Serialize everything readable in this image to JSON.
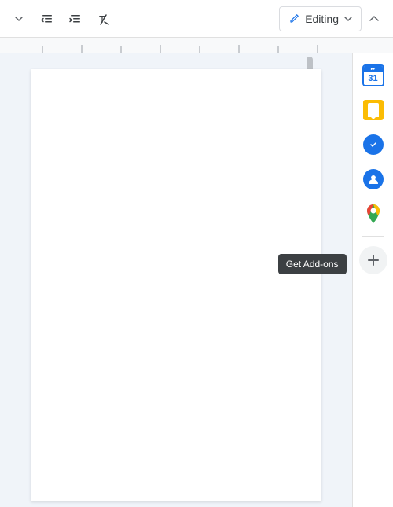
{
  "toolbar": {
    "editing_label": "Editing",
    "list_decrease_icon": "list-decrease-icon",
    "list_increase_icon": "list-increase-icon",
    "clear_format_icon": "clear-format-icon",
    "collapse_icon": "collapse-icon"
  },
  "sidebar": {
    "addons": [
      {
        "id": "google-calendar",
        "label": "Google Calendar",
        "type": "calendar"
      },
      {
        "id": "google-keep",
        "label": "Google Keep",
        "type": "keep"
      },
      {
        "id": "google-tasks",
        "label": "Google Tasks",
        "type": "tasks"
      },
      {
        "id": "google-contacts",
        "label": "Google Contacts",
        "type": "contacts"
      },
      {
        "id": "google-maps",
        "label": "Google Maps",
        "type": "maps"
      }
    ],
    "add_addons_label": "Get Add-ons",
    "add_addons_tooltip": "Get Add-ons"
  },
  "document": {
    "page_bg": "#ffffff"
  }
}
